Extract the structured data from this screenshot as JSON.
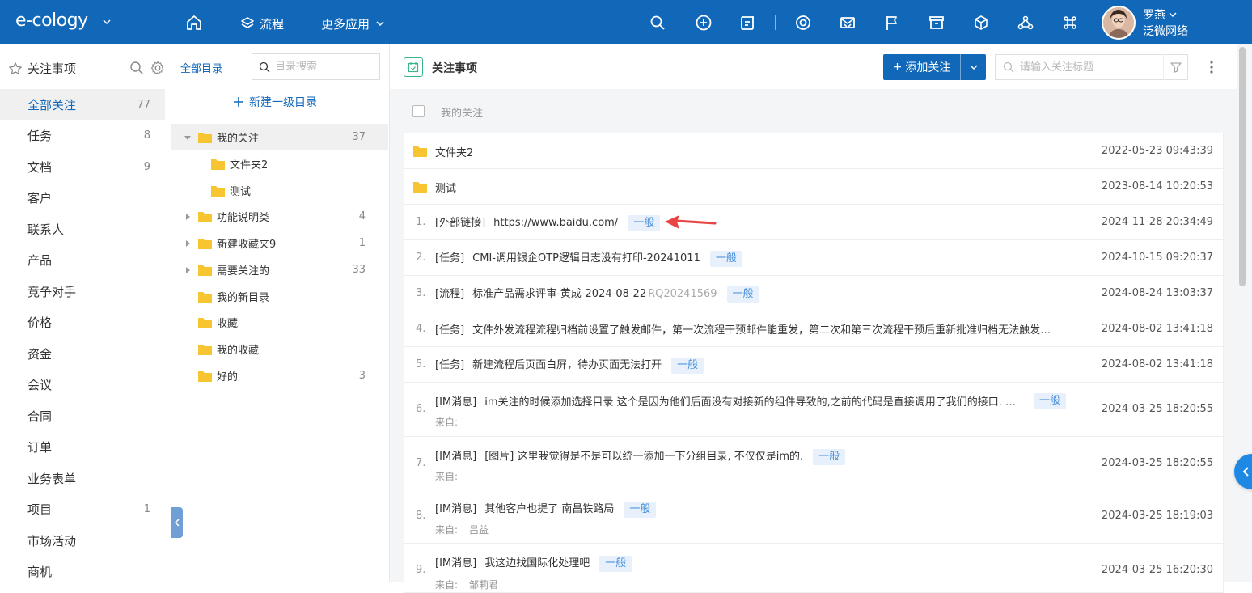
{
  "topbar": {
    "logo": "e-cology",
    "nav_flow": "流程",
    "nav_more": "更多应用",
    "icons": [
      "search-icon",
      "add-circle-icon",
      "note-icon",
      "target-icon",
      "mail-icon",
      "flag-icon",
      "archive-icon",
      "cube-icon",
      "network-icon",
      "command-icon"
    ],
    "user_name": "罗燕",
    "user_company": "泛微网络"
  },
  "col1": {
    "header": "关注事项",
    "items": [
      {
        "label": "全部关注",
        "count": "77",
        "active": true
      },
      {
        "label": "任务",
        "count": "8"
      },
      {
        "label": "文档",
        "count": "9"
      },
      {
        "label": "客户",
        "count": ""
      },
      {
        "label": "联系人",
        "count": ""
      },
      {
        "label": "产品",
        "count": ""
      },
      {
        "label": "竞争对手",
        "count": ""
      },
      {
        "label": "价格",
        "count": ""
      },
      {
        "label": "资金",
        "count": ""
      },
      {
        "label": "会议",
        "count": ""
      },
      {
        "label": "合同",
        "count": ""
      },
      {
        "label": "订单",
        "count": ""
      },
      {
        "label": "业务表单",
        "count": ""
      },
      {
        "label": "项目",
        "count": "1"
      },
      {
        "label": "市场活动",
        "count": ""
      },
      {
        "label": "商机",
        "count": ""
      }
    ]
  },
  "col2": {
    "root": "全部目录",
    "search_placeholder": "目录搜索",
    "new_root": "新建一级目录",
    "tree": [
      {
        "label": "我的关注",
        "count": "37",
        "level": 0,
        "expanded": true,
        "selected": true
      },
      {
        "label": "文件夹2",
        "count": "",
        "level": 1
      },
      {
        "label": "测试",
        "count": "",
        "level": 1
      },
      {
        "label": "功能说明类",
        "count": "4",
        "level": 0,
        "collapsed": true
      },
      {
        "label": "新建收藏夹9",
        "count": "1",
        "level": 0,
        "collapsed": true
      },
      {
        "label": "需要关注的",
        "count": "33",
        "level": 0,
        "collapsed": true
      },
      {
        "label": "我的新目录",
        "count": "",
        "level": 0
      },
      {
        "label": "收藏",
        "count": "",
        "level": 0
      },
      {
        "label": "我的收藏",
        "count": "",
        "level": 0
      },
      {
        "label": "好的",
        "count": "3",
        "level": 0
      }
    ]
  },
  "main": {
    "title": "关注事项",
    "add_button": "添加关注",
    "search_placeholder": "请输入关注标题",
    "my_follow": "我的关注",
    "rows": [
      {
        "kind": "folder",
        "title": "文件夹2",
        "time": "2022-05-23 09:43:39"
      },
      {
        "kind": "folder",
        "title": "测试",
        "time": "2023-08-14 10:20:53"
      },
      {
        "kind": "item",
        "num": "1.",
        "type": "[外部链接]",
        "title": "https://www.baidu.com/",
        "sub": "",
        "tag": "一般",
        "from": "",
        "time": "2024-11-28 20:34:49"
      },
      {
        "kind": "item",
        "num": "2.",
        "type": "[任务]",
        "title": "CMI-调用银企OTP逻辑日志没有打印-20241011",
        "sub": "",
        "tag": "一般",
        "from": "",
        "time": "2024-10-15 09:20:37"
      },
      {
        "kind": "item",
        "num": "3.",
        "type": "[流程]",
        "title": "标准产品需求评审-黄成-2024-08-22",
        "sub": "RQ20241569",
        "tag": "一般",
        "from": "",
        "time": "2024-08-24 13:03:37"
      },
      {
        "kind": "item",
        "num": "4.",
        "type": "[任务]",
        "title": "文件外发流程流程归档前设置了触发邮件，第一次流程干预邮件能重发，第二次和第三次流程干预后重新批准归档无法触发…",
        "sub": "",
        "tag": "",
        "from": "",
        "time": "2024-08-02 13:41:18"
      },
      {
        "kind": "item",
        "num": "5.",
        "type": "[任务]",
        "title": "新建流程后页面白屏，待办页面无法打开",
        "sub": "",
        "tag": "一般",
        "from": "",
        "time": "2024-08-02 13:41:18"
      },
      {
        "kind": "item",
        "num": "6.",
        "type": "[IM消息]",
        "title": "im关注的时候添加选择目录 这个是因为他们后面没有对接新的组件导致的,之前的代码是直接调用了我们的接口. …",
        "sub": "",
        "tag": "一般",
        "from_label": "来自:",
        "from": "",
        "time": "2024-03-25 18:20:55"
      },
      {
        "kind": "item",
        "num": "7.",
        "type": "[IM消息]",
        "title": "[图片] 这里我觉得是不是可以统一添加一下分组目录, 不仅仅是im的.",
        "sub": "",
        "tag": "一般",
        "from_label": "来自:",
        "from": "",
        "time": "2024-03-25 18:20:55"
      },
      {
        "kind": "item",
        "num": "8.",
        "type": "[IM消息]",
        "title": "其他客户也提了 南昌铁路局",
        "sub": "",
        "tag": "一般",
        "from_label": "来自:",
        "from": "吕益",
        "time": "2024-03-25 18:19:03"
      },
      {
        "kind": "item",
        "num": "9.",
        "type": "[IM消息]",
        "title": "我这边找国际化处理吧",
        "sub": "",
        "tag": "一般",
        "from_label": "来自:",
        "from": "邹莉君",
        "time": "2024-03-25 16:20:30"
      }
    ]
  },
  "colors": {
    "brand": "#1268b8",
    "folder": "#f7c531",
    "tag_bg": "#e8f1fb",
    "tag_text": "#4a90d9",
    "annotation_arrow": "#e84545"
  }
}
